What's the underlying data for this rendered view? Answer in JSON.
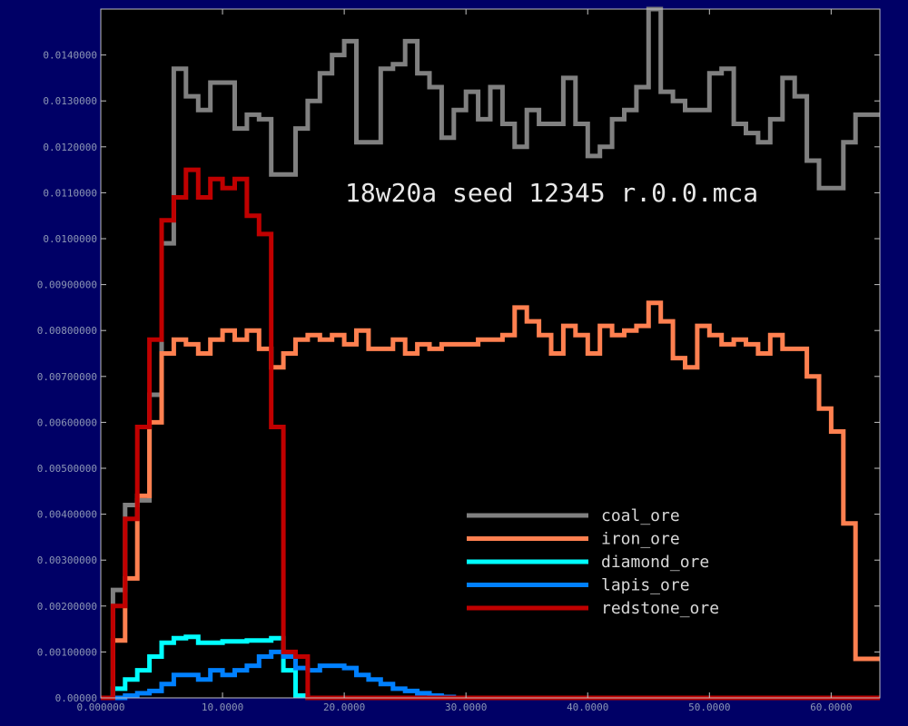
{
  "chart_data": {
    "type": "line",
    "step": true,
    "title": "18w20a seed 12345 r.0.0.mca",
    "xlabel": "",
    "ylabel": "",
    "xlim": [
      0,
      64
    ],
    "ylim": [
      0,
      0.015
    ],
    "grid": false,
    "legend_position": "lower-center-right",
    "background": "#000000",
    "figure_background": "#000066",
    "x_ticks": [
      {
        "value": 0,
        "label": "0.000000"
      },
      {
        "value": 10,
        "label": "10.0000"
      },
      {
        "value": 20,
        "label": "20.0000"
      },
      {
        "value": 30,
        "label": "30.0000"
      },
      {
        "value": 40,
        "label": "40.0000"
      },
      {
        "value": 50,
        "label": "50.0000"
      },
      {
        "value": 60,
        "label": "60.0000"
      }
    ],
    "y_ticks": [
      {
        "value": 0,
        "label": "0.00000"
      },
      {
        "value": 0.001,
        "label": "0.00100000"
      },
      {
        "value": 0.002,
        "label": "0.00200000"
      },
      {
        "value": 0.003,
        "label": "0.00300000"
      },
      {
        "value": 0.004,
        "label": "0.00400000"
      },
      {
        "value": 0.005,
        "label": "0.00500000"
      },
      {
        "value": 0.006,
        "label": "0.00600000"
      },
      {
        "value": 0.007,
        "label": "0.00700000"
      },
      {
        "value": 0.008,
        "label": "0.00800000"
      },
      {
        "value": 0.009,
        "label": "0.00900000"
      },
      {
        "value": 0.01,
        "label": "0.0100000"
      },
      {
        "value": 0.011,
        "label": "0.0110000"
      },
      {
        "value": 0.012,
        "label": "0.0120000"
      },
      {
        "value": 0.013,
        "label": "0.0130000"
      },
      {
        "value": 0.014,
        "label": "0.0140000"
      }
    ],
    "series": [
      {
        "name": "coal_ore",
        "color": "#808080",
        "values": [
          0,
          0.00235,
          0.0042,
          0.0043,
          0.0066,
          0.0099,
          0.0137,
          0.0131,
          0.0128,
          0.0134,
          0.0134,
          0.0124,
          0.0127,
          0.0126,
          0.0114,
          0.0114,
          0.0124,
          0.013,
          0.0136,
          0.014,
          0.0143,
          0.0121,
          0.0121,
          0.0137,
          0.0138,
          0.0143,
          0.0136,
          0.0133,
          0.0122,
          0.0128,
          0.0132,
          0.0126,
          0.0133,
          0.0125,
          0.012,
          0.0128,
          0.0125,
          0.0125,
          0.0135,
          0.0125,
          0.0118,
          0.012,
          0.0126,
          0.0128,
          0.0133,
          0.0152,
          0.0132,
          0.013,
          0.0128,
          0.0128,
          0.0136,
          0.0137,
          0.0125,
          0.0123,
          0.0121,
          0.0126,
          0.0135,
          0.0131,
          0.0117,
          0.0111,
          0.0111,
          0.0121,
          0.0127,
          0.0127
        ]
      },
      {
        "name": "iron_ore",
        "color": "#ff8050",
        "values": [
          0,
          0.00125,
          0.0026,
          0.0044,
          0.006,
          0.0075,
          0.0078,
          0.0077,
          0.0075,
          0.0078,
          0.008,
          0.0078,
          0.008,
          0.0076,
          0.0072,
          0.0075,
          0.0078,
          0.0079,
          0.0078,
          0.0079,
          0.0077,
          0.008,
          0.0076,
          0.0076,
          0.0078,
          0.0075,
          0.0077,
          0.0076,
          0.0077,
          0.0077,
          0.0077,
          0.0078,
          0.0078,
          0.0079,
          0.0085,
          0.0082,
          0.0079,
          0.0075,
          0.0081,
          0.0079,
          0.0075,
          0.0081,
          0.0079,
          0.008,
          0.0081,
          0.0086,
          0.0082,
          0.0074,
          0.0072,
          0.0081,
          0.0079,
          0.0077,
          0.0078,
          0.0077,
          0.0075,
          0.0079,
          0.0076,
          0.0076,
          0.007,
          0.0063,
          0.0058,
          0.0038,
          0.00085,
          0.00085
        ]
      },
      {
        "name": "diamond_ore",
        "color": "#00ffff",
        "values": [
          0,
          0.0002,
          0.0004,
          0.0006,
          0.0009,
          0.0012,
          0.0013,
          0.00133,
          0.0012,
          0.0012,
          0.00123,
          0.00123,
          0.00125,
          0.00125,
          0.0013,
          0.0006,
          5e-05,
          0,
          0,
          0,
          0,
          0,
          0,
          0,
          0,
          0,
          0,
          0,
          0,
          0,
          0,
          0,
          0,
          0,
          0,
          0,
          0,
          0,
          0,
          0,
          0,
          0,
          0,
          0,
          0,
          0,
          0,
          0,
          0,
          0,
          0,
          0,
          0,
          0,
          0,
          0,
          0,
          0,
          0,
          0,
          0,
          0,
          0,
          0
        ]
      },
      {
        "name": "lapis_ore",
        "color": "#0080ff",
        "values": [
          0,
          0,
          5e-05,
          0.0001,
          0.00015,
          0.0003,
          0.0005,
          0.0005,
          0.0004,
          0.0006,
          0.0005,
          0.0006,
          0.0007,
          0.0009,
          0.001,
          0.0009,
          0.00065,
          0.0006,
          0.0007,
          0.0007,
          0.00065,
          0.0005,
          0.0004,
          0.0003,
          0.0002,
          0.00015,
          0.0001,
          5e-05,
          2e-05,
          0,
          0,
          0,
          0,
          0,
          0,
          0,
          0,
          0,
          0,
          0,
          0,
          0,
          0,
          0,
          0,
          0,
          0,
          0,
          0,
          0,
          0,
          0,
          0,
          0,
          0,
          0,
          0,
          0,
          0,
          0,
          0,
          0,
          0,
          0
        ]
      },
      {
        "name": "redstone_ore",
        "color": "#c00000",
        "values": [
          0,
          0.002,
          0.0039,
          0.0059,
          0.0078,
          0.0104,
          0.0109,
          0.0115,
          0.0109,
          0.0113,
          0.0111,
          0.0113,
          0.0105,
          0.0101,
          0.0059,
          0.001,
          0.0009,
          0,
          0,
          0,
          0,
          0,
          0,
          0,
          0,
          0,
          0,
          0,
          0,
          0,
          0,
          0,
          0,
          0,
          0,
          0,
          0,
          0,
          0,
          0,
          0,
          0,
          0,
          0,
          0,
          0,
          0,
          0,
          0,
          0,
          0,
          0,
          0,
          0,
          0,
          0,
          0,
          0,
          0,
          0,
          0,
          0,
          0,
          0
        ]
      }
    ]
  }
}
